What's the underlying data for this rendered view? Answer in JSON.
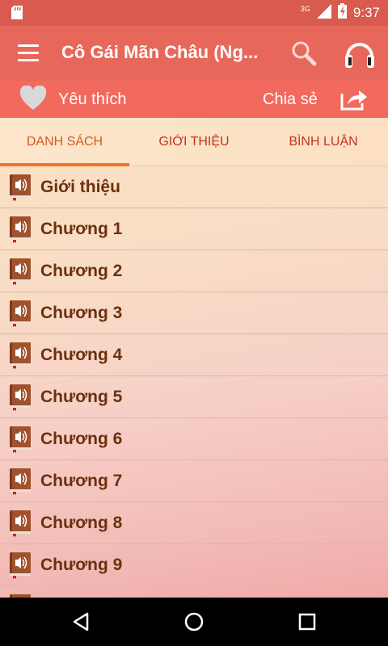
{
  "status_bar": {
    "network": "3G",
    "time": "9:37"
  },
  "app_bar": {
    "title": "Cô Gái Mãn Châu (Ng..."
  },
  "action_bar": {
    "favorite_label": "Yêu thích",
    "share_label": "Chia sẻ"
  },
  "tabs": [
    {
      "label": "DANH SÁCH",
      "active": true
    },
    {
      "label": "GIỚI THIỆU",
      "active": false
    },
    {
      "label": "BÌNH LUẬN",
      "active": false
    }
  ],
  "list": [
    {
      "label": "Giới thiệu"
    },
    {
      "label": "Chương 1"
    },
    {
      "label": "Chương 2"
    },
    {
      "label": "Chương 3"
    },
    {
      "label": "Chương 4"
    },
    {
      "label": "Chương 5"
    },
    {
      "label": "Chương 6"
    },
    {
      "label": "Chương 7"
    },
    {
      "label": "Chương 8"
    },
    {
      "label": "Chương 9"
    },
    {
      "label": ""
    }
  ],
  "colors": {
    "status_bar": "#d95a4e",
    "app_bar": "#e8675b",
    "action_bar": "#f2695d",
    "tab_active_indicator": "#f07525",
    "list_text": "#6b300f"
  }
}
